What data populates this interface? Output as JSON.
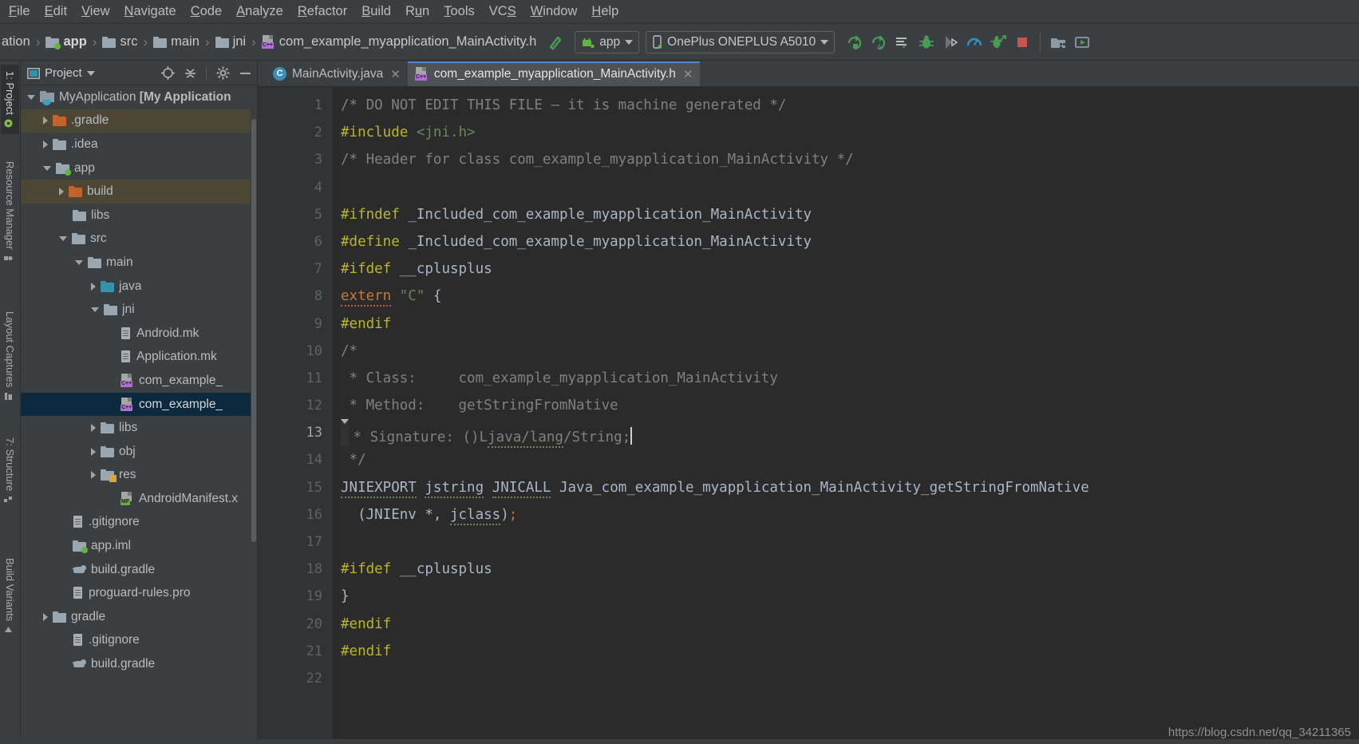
{
  "window": {
    "menu": [
      {
        "label": "File",
        "mnemonic": "F"
      },
      {
        "label": "Edit",
        "mnemonic": "E"
      },
      {
        "label": "View",
        "mnemonic": "V"
      },
      {
        "label": "Navigate",
        "mnemonic": "N"
      },
      {
        "label": "Code",
        "mnemonic": "C"
      },
      {
        "label": "Analyze",
        "mnemonic": "A"
      },
      {
        "label": "Refactor",
        "mnemonic": "R"
      },
      {
        "label": "Build",
        "mnemonic": "B"
      },
      {
        "label": "Run",
        "mnemonic": "u"
      },
      {
        "label": "Tools",
        "mnemonic": "T"
      },
      {
        "label": "VCS",
        "mnemonic": "S"
      },
      {
        "label": "Window",
        "mnemonic": "W"
      },
      {
        "label": "Help",
        "mnemonic": "H"
      }
    ]
  },
  "navbar": {
    "crumbs": [
      {
        "label": "ation",
        "icon": "none",
        "bold": false
      },
      {
        "label": "app",
        "icon": "folder-green",
        "bold": true
      },
      {
        "label": "src",
        "icon": "folder",
        "bold": false
      },
      {
        "label": "main",
        "icon": "folder",
        "bold": false
      },
      {
        "label": "jni",
        "icon": "folder",
        "bold": false
      },
      {
        "label": "com_example_myapplication_MainActivity.h",
        "icon": "cpp-header",
        "bold": false
      }
    ]
  },
  "toolbar": {
    "run_config": "app",
    "device": "OnePlus ONEPLUS A5010",
    "buttons": [
      {
        "name": "make-project-icon",
        "glyph": "hammer"
      },
      {
        "name": "run-icon",
        "glyph": "run"
      },
      {
        "name": "apply-changes-icon",
        "glyph": "apply-changes"
      },
      {
        "name": "apply-code-changes-icon",
        "glyph": "apply-code-changes"
      },
      {
        "name": "attach-debugger-icon",
        "glyph": "attach"
      },
      {
        "name": "debug-icon",
        "glyph": "bug"
      },
      {
        "name": "run-to-cursor-icon",
        "glyph": "run-cursor"
      },
      {
        "name": "profiler-icon",
        "glyph": "profiler"
      },
      {
        "name": "attach-debugger-process-icon",
        "glyph": "attach-process"
      },
      {
        "name": "stop-icon",
        "glyph": "stop"
      },
      {
        "name": "sdk-manager-icon",
        "glyph": "sdk"
      },
      {
        "name": "avd-manager-icon",
        "glyph": "avd"
      }
    ]
  },
  "sidebar_tabs": [
    {
      "label": "1: Project",
      "active": true,
      "icon": "android-icon"
    },
    {
      "label": "Resource Manager",
      "active": false,
      "icon": "resource-icon"
    },
    {
      "label": "Layout Captures",
      "active": false,
      "icon": "layout-icon"
    },
    {
      "label": "7: Structure",
      "active": false,
      "icon": "structure-icon"
    },
    {
      "label": "Build Variants",
      "active": false,
      "icon": "variants-icon"
    }
  ],
  "project_panel": {
    "title": "Project",
    "tree": [
      {
        "label": "MyApplication [My Application",
        "bold_from": 14,
        "indent": 0,
        "arrow": "open",
        "icon": "module",
        "state": "normal"
      },
      {
        "label": ".gradle",
        "indent": 1,
        "arrow": "closed",
        "icon": "folder-orange",
        "state": "hl"
      },
      {
        "label": ".idea",
        "indent": 1,
        "arrow": "closed",
        "icon": "folder",
        "state": "normal"
      },
      {
        "label": "app",
        "indent": 1,
        "arrow": "open",
        "icon": "folder-green",
        "state": "normal"
      },
      {
        "label": "build",
        "indent": 2,
        "arrow": "closed",
        "icon": "folder-orange",
        "state": "hl"
      },
      {
        "label": "libs",
        "indent": 2,
        "arrow": "none",
        "icon": "folder",
        "state": "normal"
      },
      {
        "label": "src",
        "indent": 2,
        "arrow": "open",
        "icon": "folder",
        "state": "normal"
      },
      {
        "label": "main",
        "indent": 3,
        "arrow": "open",
        "icon": "folder",
        "state": "normal"
      },
      {
        "label": "java",
        "indent": 4,
        "arrow": "closed",
        "icon": "folder-teal",
        "state": "normal"
      },
      {
        "label": "jni",
        "indent": 4,
        "arrow": "open",
        "icon": "folder",
        "state": "normal"
      },
      {
        "label": "Android.mk",
        "indent": 5,
        "arrow": "none",
        "icon": "doc",
        "state": "normal"
      },
      {
        "label": "Application.mk",
        "indent": 5,
        "arrow": "none",
        "icon": "doc",
        "state": "normal"
      },
      {
        "label": "com_example_",
        "indent": 5,
        "arrow": "none",
        "icon": "cpp-header",
        "state": "normal"
      },
      {
        "label": "com_example_",
        "indent": 5,
        "arrow": "none",
        "icon": "cpp-header",
        "state": "sel"
      },
      {
        "label": "libs",
        "indent": 4,
        "arrow": "closed",
        "icon": "folder",
        "state": "normal"
      },
      {
        "label": "obj",
        "indent": 4,
        "arrow": "closed",
        "icon": "folder",
        "state": "normal"
      },
      {
        "label": "res",
        "indent": 4,
        "arrow": "closed",
        "icon": "folder-res",
        "state": "normal"
      },
      {
        "label": "AndroidManifest.x",
        "indent": 5,
        "arrow": "none",
        "icon": "manifest",
        "state": "normal"
      },
      {
        "label": ".gitignore",
        "indent": 2,
        "arrow": "none",
        "icon": "doc",
        "state": "normal"
      },
      {
        "label": "app.iml",
        "indent": 2,
        "arrow": "none",
        "icon": "folder-green",
        "state": "normal"
      },
      {
        "label": "build.gradle",
        "indent": 2,
        "arrow": "none",
        "icon": "gradle",
        "state": "normal"
      },
      {
        "label": "proguard-rules.pro",
        "indent": 2,
        "arrow": "none",
        "icon": "doc",
        "state": "normal"
      },
      {
        "label": "gradle",
        "indent": 1,
        "arrow": "closed",
        "icon": "folder",
        "state": "normal"
      },
      {
        "label": ".gitignore",
        "indent": 2,
        "arrow": "none",
        "icon": "doc",
        "state": "normal"
      },
      {
        "label": "build.gradle",
        "indent": 2,
        "arrow": "none",
        "icon": "gradle",
        "state": "normal"
      }
    ]
  },
  "editor": {
    "tabs": [
      {
        "label": "MainActivity.java",
        "icon": "java-class-icon",
        "active": false,
        "closable": true
      },
      {
        "label": "com_example_myapplication_MainActivity.h",
        "icon": "cpp-header-icon",
        "active": true,
        "closable": true
      }
    ],
    "caret_line": 13,
    "line_count": 22,
    "lines": [
      {
        "n": 1,
        "tokens": [
          {
            "t": "/* DO NOT EDIT THIS FILE – it is machine generated */",
            "c": "cmt"
          }
        ]
      },
      {
        "n": 2,
        "tokens": [
          {
            "t": "#include ",
            "c": "pre"
          },
          {
            "t": "<jni.h>",
            "c": "str"
          }
        ]
      },
      {
        "n": 3,
        "tokens": [
          {
            "t": "/* Header for class com_example_myapplication_MainActivity */",
            "c": "cmt"
          }
        ]
      },
      {
        "n": 4,
        "tokens": []
      },
      {
        "n": 5,
        "tokens": [
          {
            "t": "#ifndef ",
            "c": "pre"
          },
          {
            "t": "_Included_com_example_myapplication_MainActivity",
            "c": "def"
          }
        ]
      },
      {
        "n": 6,
        "tokens": [
          {
            "t": "#define ",
            "c": "pre"
          },
          {
            "t": "_Included_com_example_myapplication_MainActivity",
            "c": "def"
          }
        ]
      },
      {
        "n": 7,
        "tokens": [
          {
            "t": "#ifdef ",
            "c": "pre"
          },
          {
            "t": "__cplusplus",
            "c": "def"
          }
        ]
      },
      {
        "n": 8,
        "tokens": [
          {
            "t": "extern",
            "c": "kw",
            "sq": "red"
          },
          {
            "t": " ",
            "c": "def"
          },
          {
            "t": "\"C\"",
            "c": "str"
          },
          {
            "t": " {",
            "c": "def"
          }
        ]
      },
      {
        "n": 9,
        "tokens": [
          {
            "t": "#endif",
            "c": "pre"
          }
        ]
      },
      {
        "n": 10,
        "tokens": [
          {
            "t": "/*",
            "c": "cmt"
          }
        ]
      },
      {
        "n": 11,
        "tokens": [
          {
            "t": " * Class:     com_example_myapplication_MainActivity",
            "c": "cmt"
          }
        ]
      },
      {
        "n": 12,
        "tokens": [
          {
            "t": " * Method:    getStringFromNative",
            "c": "cmt"
          }
        ]
      },
      {
        "n": 13,
        "tokens": [
          {
            "t": " * Signature: ()L",
            "c": "cmt"
          },
          {
            "t": "java/lang",
            "c": "cmt",
            "sq": "green"
          },
          {
            "t": "/String;",
            "c": "cmt"
          }
        ],
        "caret": true
      },
      {
        "n": 14,
        "tokens": [
          {
            "t": " */",
            "c": "cmt"
          }
        ]
      },
      {
        "n": 15,
        "tokens": [
          {
            "t": "JNIEXPORT",
            "c": "def",
            "sq": "green"
          },
          {
            "t": " ",
            "c": "def"
          },
          {
            "t": "jstring",
            "c": "def",
            "sq": "green"
          },
          {
            "t": " ",
            "c": "def"
          },
          {
            "t": "JNICALL",
            "c": "def",
            "sq": "green"
          },
          {
            "t": " Java_com_example_myapplication_MainActivity_getStringFromNative",
            "c": "def"
          }
        ]
      },
      {
        "n": 16,
        "tokens": [
          {
            "t": "  (JNIEnv *, ",
            "c": "def"
          },
          {
            "t": "jclass",
            "c": "def",
            "sq": "green"
          },
          {
            "t": ")",
            "c": "def"
          },
          {
            "t": ";",
            "c": "kw"
          }
        ]
      },
      {
        "n": 17,
        "tokens": []
      },
      {
        "n": 18,
        "tokens": [
          {
            "t": "#ifdef ",
            "c": "pre"
          },
          {
            "t": "__cplusplus",
            "c": "def"
          }
        ]
      },
      {
        "n": 19,
        "tokens": [
          {
            "t": "}",
            "c": "def"
          }
        ]
      },
      {
        "n": 20,
        "tokens": [
          {
            "t": "#endif",
            "c": "pre"
          }
        ]
      },
      {
        "n": 21,
        "tokens": [
          {
            "t": "#endif",
            "c": "pre"
          }
        ]
      },
      {
        "n": 22,
        "tokens": []
      }
    ]
  },
  "watermark": "https://blog.csdn.net/qq_34211365",
  "colors": {
    "chrome": "#3c3f41",
    "editor_bg": "#2b2b2b",
    "gutter_bg": "#313335",
    "selection": "#0d293e",
    "highlight": "#4b4734",
    "accent_blue": "#4a88c7",
    "green": "#499c54",
    "stop_red": "#c75450",
    "comment": "#808080",
    "preprocessor": "#bbb529",
    "string": "#6a8759",
    "keyword": "#cc7832"
  }
}
